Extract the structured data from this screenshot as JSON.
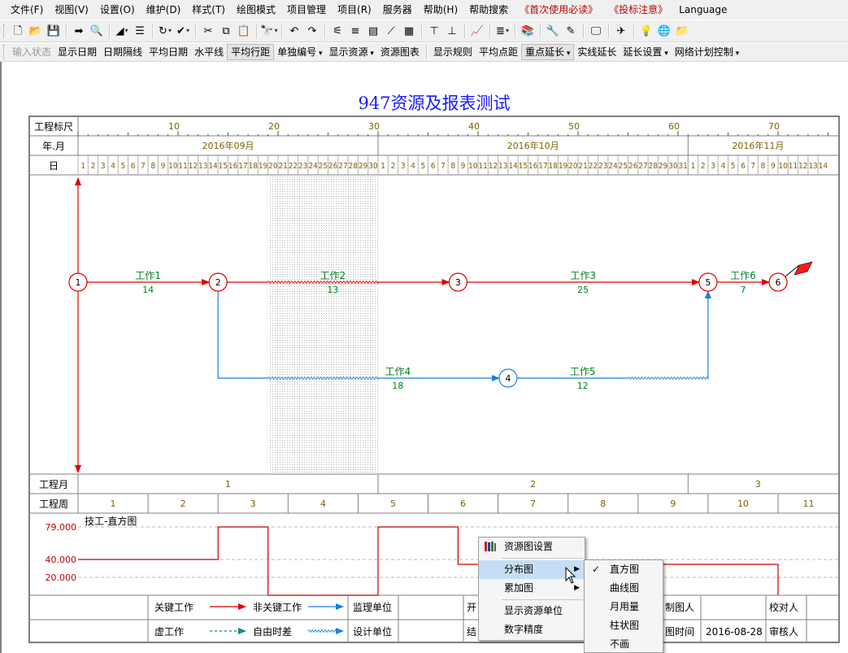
{
  "menubar": [
    {
      "name": "menu-file",
      "label": "文件(F)",
      "red": false
    },
    {
      "name": "menu-view",
      "label": "视图(V)",
      "red": false
    },
    {
      "name": "menu-settings",
      "label": "设置(O)",
      "red": false
    },
    {
      "name": "menu-maintain",
      "label": "维护(D)",
      "red": false
    },
    {
      "name": "menu-style",
      "label": "样式(T)",
      "red": false
    },
    {
      "name": "menu-draw-mode",
      "label": "绘图模式",
      "red": false
    },
    {
      "name": "menu-project-manage",
      "label": "项目管理",
      "red": false
    },
    {
      "name": "menu-project",
      "label": "项目(R)",
      "red": false
    },
    {
      "name": "menu-server",
      "label": "服务器",
      "red": false
    },
    {
      "name": "menu-help",
      "label": "帮助(H)",
      "red": false
    },
    {
      "name": "menu-help-search",
      "label": "帮助搜索",
      "red": false
    },
    {
      "name": "menu-first-use",
      "label": "《首次使用必读》",
      "red": true
    },
    {
      "name": "menu-bid-notes",
      "label": "《投标注意》",
      "red": true
    },
    {
      "name": "menu-language",
      "label": "Language",
      "red": false
    }
  ],
  "toolbar1": [
    {
      "name": "new-file-icon",
      "glyph": "🗋",
      "dd": false,
      "sep": false
    },
    {
      "name": "open-folder-icon",
      "glyph": "📂",
      "dd": false,
      "sep": false
    },
    {
      "name": "save-icon",
      "glyph": "💾",
      "dd": false,
      "sep": true
    },
    {
      "name": "export-icon",
      "glyph": "➡",
      "dd": false,
      "sep": false
    },
    {
      "name": "print-preview-icon",
      "glyph": "🔍",
      "dd": false,
      "sep": true
    },
    {
      "name": "line-style-icon",
      "glyph": "◢",
      "dd": true,
      "sep": false
    },
    {
      "name": "indent-icon",
      "glyph": "☰",
      "dd": false,
      "sep": true
    },
    {
      "name": "refresh-icon",
      "glyph": "↻",
      "dd": true,
      "sep": false
    },
    {
      "name": "check-icon",
      "glyph": "✔",
      "dd": true,
      "sep": true
    },
    {
      "name": "cut-icon",
      "glyph": "✂",
      "dd": false,
      "sep": false
    },
    {
      "name": "copy-icon",
      "glyph": "⧉",
      "dd": false,
      "sep": false
    },
    {
      "name": "paste-icon",
      "glyph": "📋",
      "dd": false,
      "sep": true
    },
    {
      "name": "find-icon",
      "glyph": "🔭",
      "dd": true,
      "sep": true
    },
    {
      "name": "undo-icon",
      "glyph": "↶",
      "dd": false,
      "sep": false
    },
    {
      "name": "redo-icon",
      "glyph": "↷",
      "dd": false,
      "sep": true
    },
    {
      "name": "network-icon",
      "glyph": "⚟",
      "dd": false,
      "sep": false
    },
    {
      "name": "gantt-icon",
      "glyph": "≡",
      "dd": false,
      "sep": false
    },
    {
      "name": "timeline-icon",
      "glyph": "▤",
      "dd": false,
      "sep": false
    },
    {
      "name": "curve-icon",
      "glyph": "⟋",
      "dd": false,
      "sep": false
    },
    {
      "name": "resource-icon",
      "glyph": "▦",
      "dd": false,
      "sep": true
    },
    {
      "name": "align-top-icon",
      "glyph": "⊤",
      "dd": false,
      "sep": false
    },
    {
      "name": "align-bottom-icon",
      "glyph": "⊥",
      "dd": false,
      "sep": true
    },
    {
      "name": "chart-icon",
      "glyph": "📈",
      "dd": false,
      "sep": true
    },
    {
      "name": "legend-icon",
      "glyph": "≣",
      "dd": true,
      "sep": true
    },
    {
      "name": "books-icon",
      "glyph": "📚",
      "dd": false,
      "sep": true
    },
    {
      "name": "tools-icon",
      "glyph": "🔧",
      "dd": false,
      "sep": false
    },
    {
      "name": "edit-icon",
      "glyph": "✎",
      "dd": false,
      "sep": true
    },
    {
      "name": "monitor-icon",
      "glyph": "🖵",
      "dd": false,
      "sep": true
    },
    {
      "name": "plane-icon",
      "glyph": "✈",
      "dd": false,
      "sep": true
    },
    {
      "name": "lightbulb-icon",
      "glyph": "💡",
      "dd": false,
      "sep": false
    },
    {
      "name": "globe-icon",
      "glyph": "🌐",
      "dd": false,
      "sep": false
    },
    {
      "name": "folder-icon",
      "glyph": "📁",
      "dd": false,
      "sep": false
    }
  ],
  "toolbar2": [
    {
      "name": "input-status-button",
      "label": "输入状态",
      "disabled": true,
      "active": false,
      "dd": false,
      "sep": false
    },
    {
      "name": "show-date-button",
      "label": "显示日期",
      "disabled": false,
      "active": false,
      "dd": false,
      "sep": false
    },
    {
      "name": "date-gridline-button",
      "label": "日期隔线",
      "disabled": false,
      "active": false,
      "dd": false,
      "sep": false
    },
    {
      "name": "avg-date-button",
      "label": "平均日期",
      "disabled": false,
      "active": false,
      "dd": false,
      "sep": false
    },
    {
      "name": "horizontal-line-button",
      "label": "水平线",
      "disabled": false,
      "active": false,
      "dd": false,
      "sep": false
    },
    {
      "name": "avg-row-spacing-button",
      "label": "平均行距",
      "disabled": false,
      "active": true,
      "dd": false,
      "sep": false
    },
    {
      "name": "single-numbering-button",
      "label": "单独编号",
      "disabled": false,
      "active": false,
      "dd": true,
      "sep": false
    },
    {
      "name": "show-resource-button",
      "label": "显示资源",
      "disabled": false,
      "active": false,
      "dd": true,
      "sep": false
    },
    {
      "name": "resource-chart-button",
      "label": "资源图表",
      "disabled": false,
      "active": false,
      "dd": false,
      "sep": true
    },
    {
      "name": "show-rules-button",
      "label": "显示规则",
      "disabled": false,
      "active": false,
      "dd": false,
      "sep": false
    },
    {
      "name": "avg-nodes-button",
      "label": "平均点距",
      "disabled": false,
      "active": false,
      "dd": false,
      "sep": false
    },
    {
      "name": "key-extend-button",
      "label": "重点延长",
      "disabled": false,
      "active": true,
      "dd": true,
      "sep": false
    },
    {
      "name": "solid-extend-button",
      "label": "实线延长",
      "disabled": false,
      "active": false,
      "dd": false,
      "sep": false
    },
    {
      "name": "extend-settings-button",
      "label": "延长设置",
      "disabled": false,
      "active": false,
      "dd": true,
      "sep": false
    },
    {
      "name": "network-control-button",
      "label": "网络计划控制",
      "disabled": false,
      "active": false,
      "dd": true,
      "sep": false
    }
  ],
  "colors": {
    "critical": "#e00000",
    "noncritical": "#1a7fe0",
    "work_label": "#00801e",
    "title": "#1a1aff",
    "date_text": "#806000",
    "hist_value": "#c00000",
    "legend_dashed": "#0a8a80"
  },
  "chart": {
    "title": "947资源及报表测试",
    "row_labels": {
      "ruler": "工程标尺",
      "month": "年.月",
      "day": "日",
      "proj_month": "工程月",
      "proj_week": "工程周"
    },
    "ruler_ticks": [
      10,
      20,
      30,
      40,
      50,
      60,
      70
    ],
    "months": [
      {
        "label": "2016年09月",
        "days": 30
      },
      {
        "label": "2016年10月",
        "days": 31
      },
      {
        "label": "2016年11月",
        "days": 14
      }
    ],
    "proj_months": [
      "1",
      "2",
      "3"
    ],
    "proj_weeks": [
      "1",
      "2",
      "3",
      "4",
      "5",
      "6",
      "7",
      "8",
      "9",
      "10",
      "11"
    ]
  },
  "network": {
    "nodes": [
      {
        "id": "1",
        "day": 0,
        "lane": "main",
        "critical": true
      },
      {
        "id": "2",
        "day": 14,
        "lane": "main",
        "critical": true
      },
      {
        "id": "3",
        "day": 38,
        "lane": "main",
        "critical": true
      },
      {
        "id": "5",
        "day": 63,
        "lane": "main",
        "critical": true
      },
      {
        "id": "6",
        "day": 70,
        "lane": "main",
        "critical": true
      },
      {
        "id": "4",
        "day": 43,
        "lane": "low",
        "critical": false
      }
    ],
    "activities": [
      {
        "name": "工作1",
        "duration": "14"
      },
      {
        "name": "工作2",
        "duration": "13"
      },
      {
        "name": "工作3",
        "duration": "25"
      },
      {
        "name": "工作6",
        "duration": "7"
      },
      {
        "name": "工作4",
        "duration": "18"
      },
      {
        "name": "工作5",
        "duration": "12"
      }
    ]
  },
  "histogram": {
    "title": "技工-直方图",
    "y_labels": [
      "79.000",
      "40.000",
      "20.000"
    ]
  },
  "legend": {
    "critical_work": "关键工作",
    "noncritical_work": "非关键工作",
    "dummy_work": "虚工作",
    "free_float": "自由时差",
    "supervision_unit": "监理单位",
    "design_unit": "设计单位",
    "start_partial": "开",
    "end_partial": "结",
    "drawer_partial": "制图人",
    "draw_time_partial": "图时间",
    "draw_date": "2016-08-28",
    "proofreader": "校对人",
    "reviewer": "审核人"
  },
  "context_menu": {
    "resource_settings": "资源图设置",
    "distribution_chart": "分布图",
    "cumulative_chart": "累加图",
    "show_resource_unit": "显示资源单位",
    "number_precision": "数字精度"
  },
  "submenu": {
    "items": [
      {
        "name": "submenu-histogram",
        "label": "直方图",
        "checked": true
      },
      {
        "name": "submenu-curve",
        "label": "曲线图",
        "checked": false
      },
      {
        "name": "submenu-monthly",
        "label": "月用量",
        "checked": false
      },
      {
        "name": "submenu-bar",
        "label": "柱状图",
        "checked": false
      },
      {
        "name": "submenu-none",
        "label": "不画",
        "checked": false
      }
    ]
  }
}
